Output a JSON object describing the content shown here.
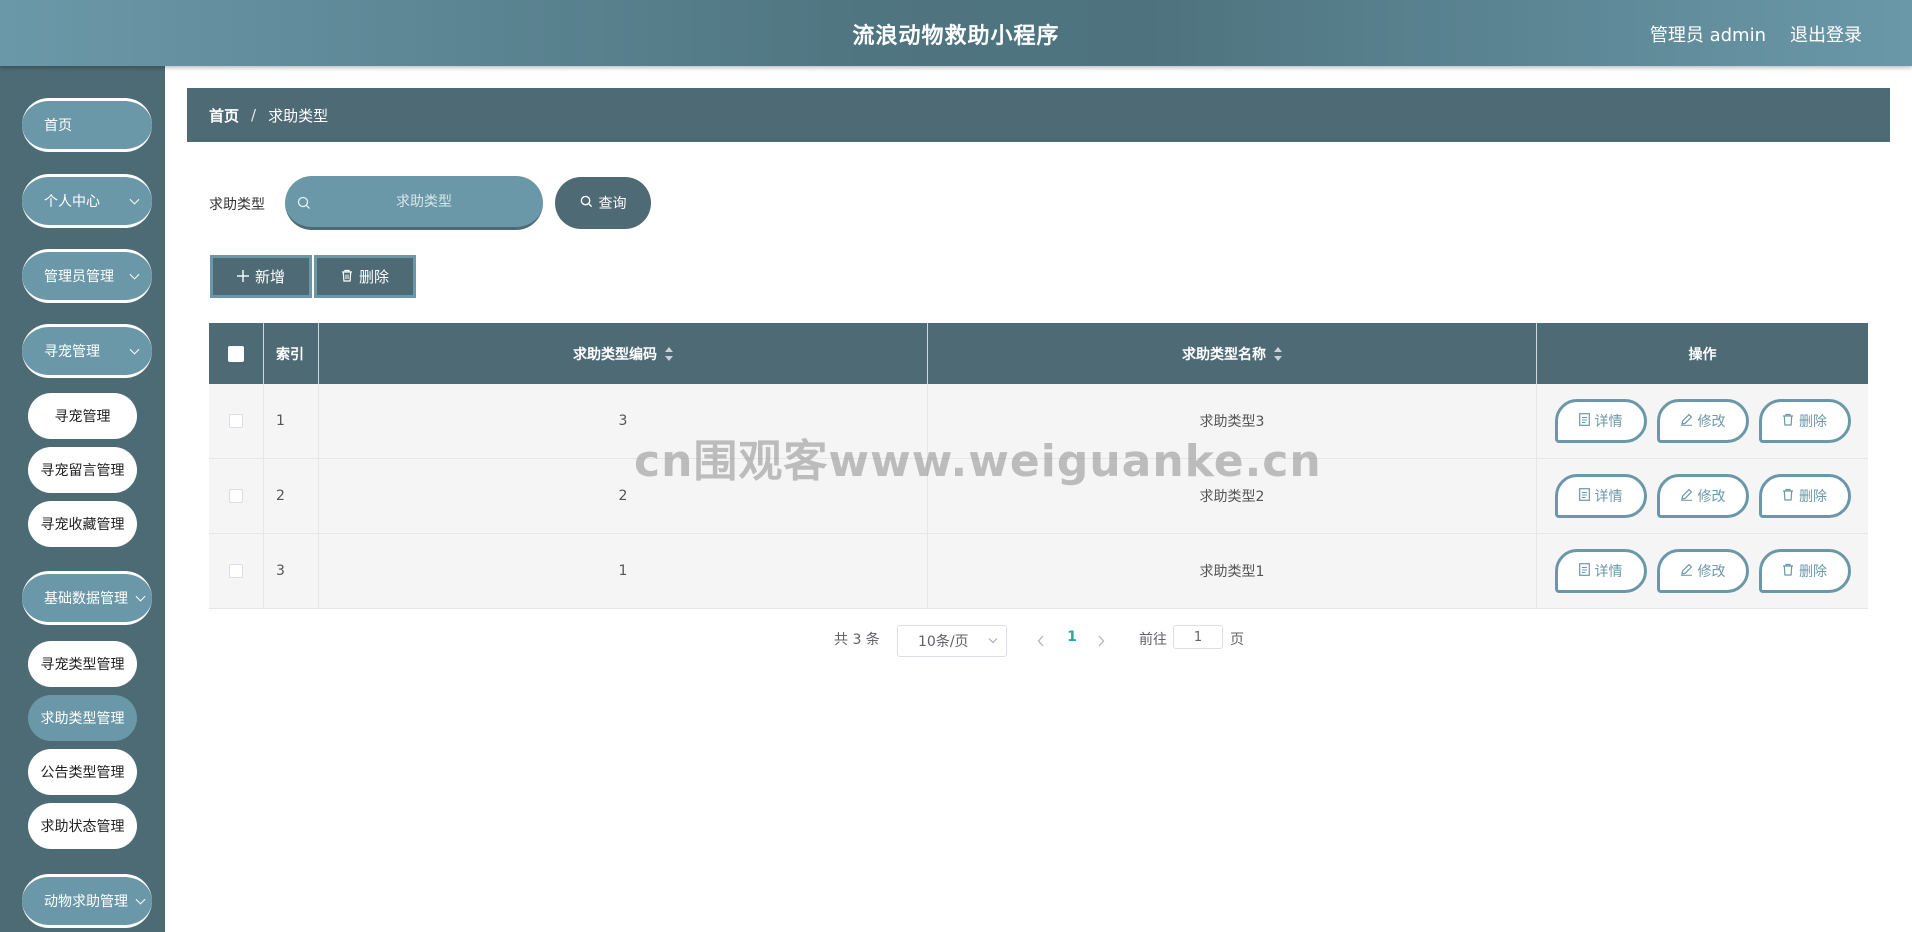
{
  "header": {
    "title": "流浪动物救助小程序",
    "user": "管理员 admin",
    "logout": "退出登录"
  },
  "sidebar": {
    "items": [
      {
        "label": "首页"
      },
      {
        "label": "个人中心"
      },
      {
        "label": "管理员管理"
      },
      {
        "label": "寻宠管理",
        "children": [
          "寻宠管理",
          "寻宠留言管理",
          "寻宠收藏管理"
        ]
      },
      {
        "label": "基础数据管理",
        "children": [
          "寻宠类型管理",
          "求助类型管理",
          "公告类型管理",
          "求助状态管理"
        ]
      },
      {
        "label": "动物求助管理"
      }
    ],
    "active_item": "求助类型管理"
  },
  "breadcrumb": {
    "home": "首页",
    "separator": "/",
    "current": "求助类型"
  },
  "search": {
    "label": "求助类型",
    "placeholder": "求助类型",
    "value": "",
    "query_label": "查询"
  },
  "actions": {
    "add_label": "新增",
    "delete_label": "删除"
  },
  "table": {
    "columns": [
      "索引",
      "求助类型编码",
      "求助类型名称",
      "操作"
    ],
    "rows": [
      {
        "index": "1",
        "code": "3",
        "name": "求助类型3"
      },
      {
        "index": "2",
        "code": "2",
        "name": "求助类型2"
      },
      {
        "index": "3",
        "code": "1",
        "name": "求助类型1"
      }
    ],
    "row_actions": {
      "detail": "详情",
      "edit": "修改",
      "delete": "删除"
    }
  },
  "pagination": {
    "total_text": "共 3 条",
    "page_size": "10条/页",
    "current_page": "1",
    "goto_label": "前往",
    "goto_value": "1",
    "unit": "页"
  },
  "watermark": "cn围观客www.weiguanke.cn",
  "colors": {
    "primary": "#4e6a75",
    "accent": "#6b98a8",
    "active_page": "#2aa8a0"
  }
}
